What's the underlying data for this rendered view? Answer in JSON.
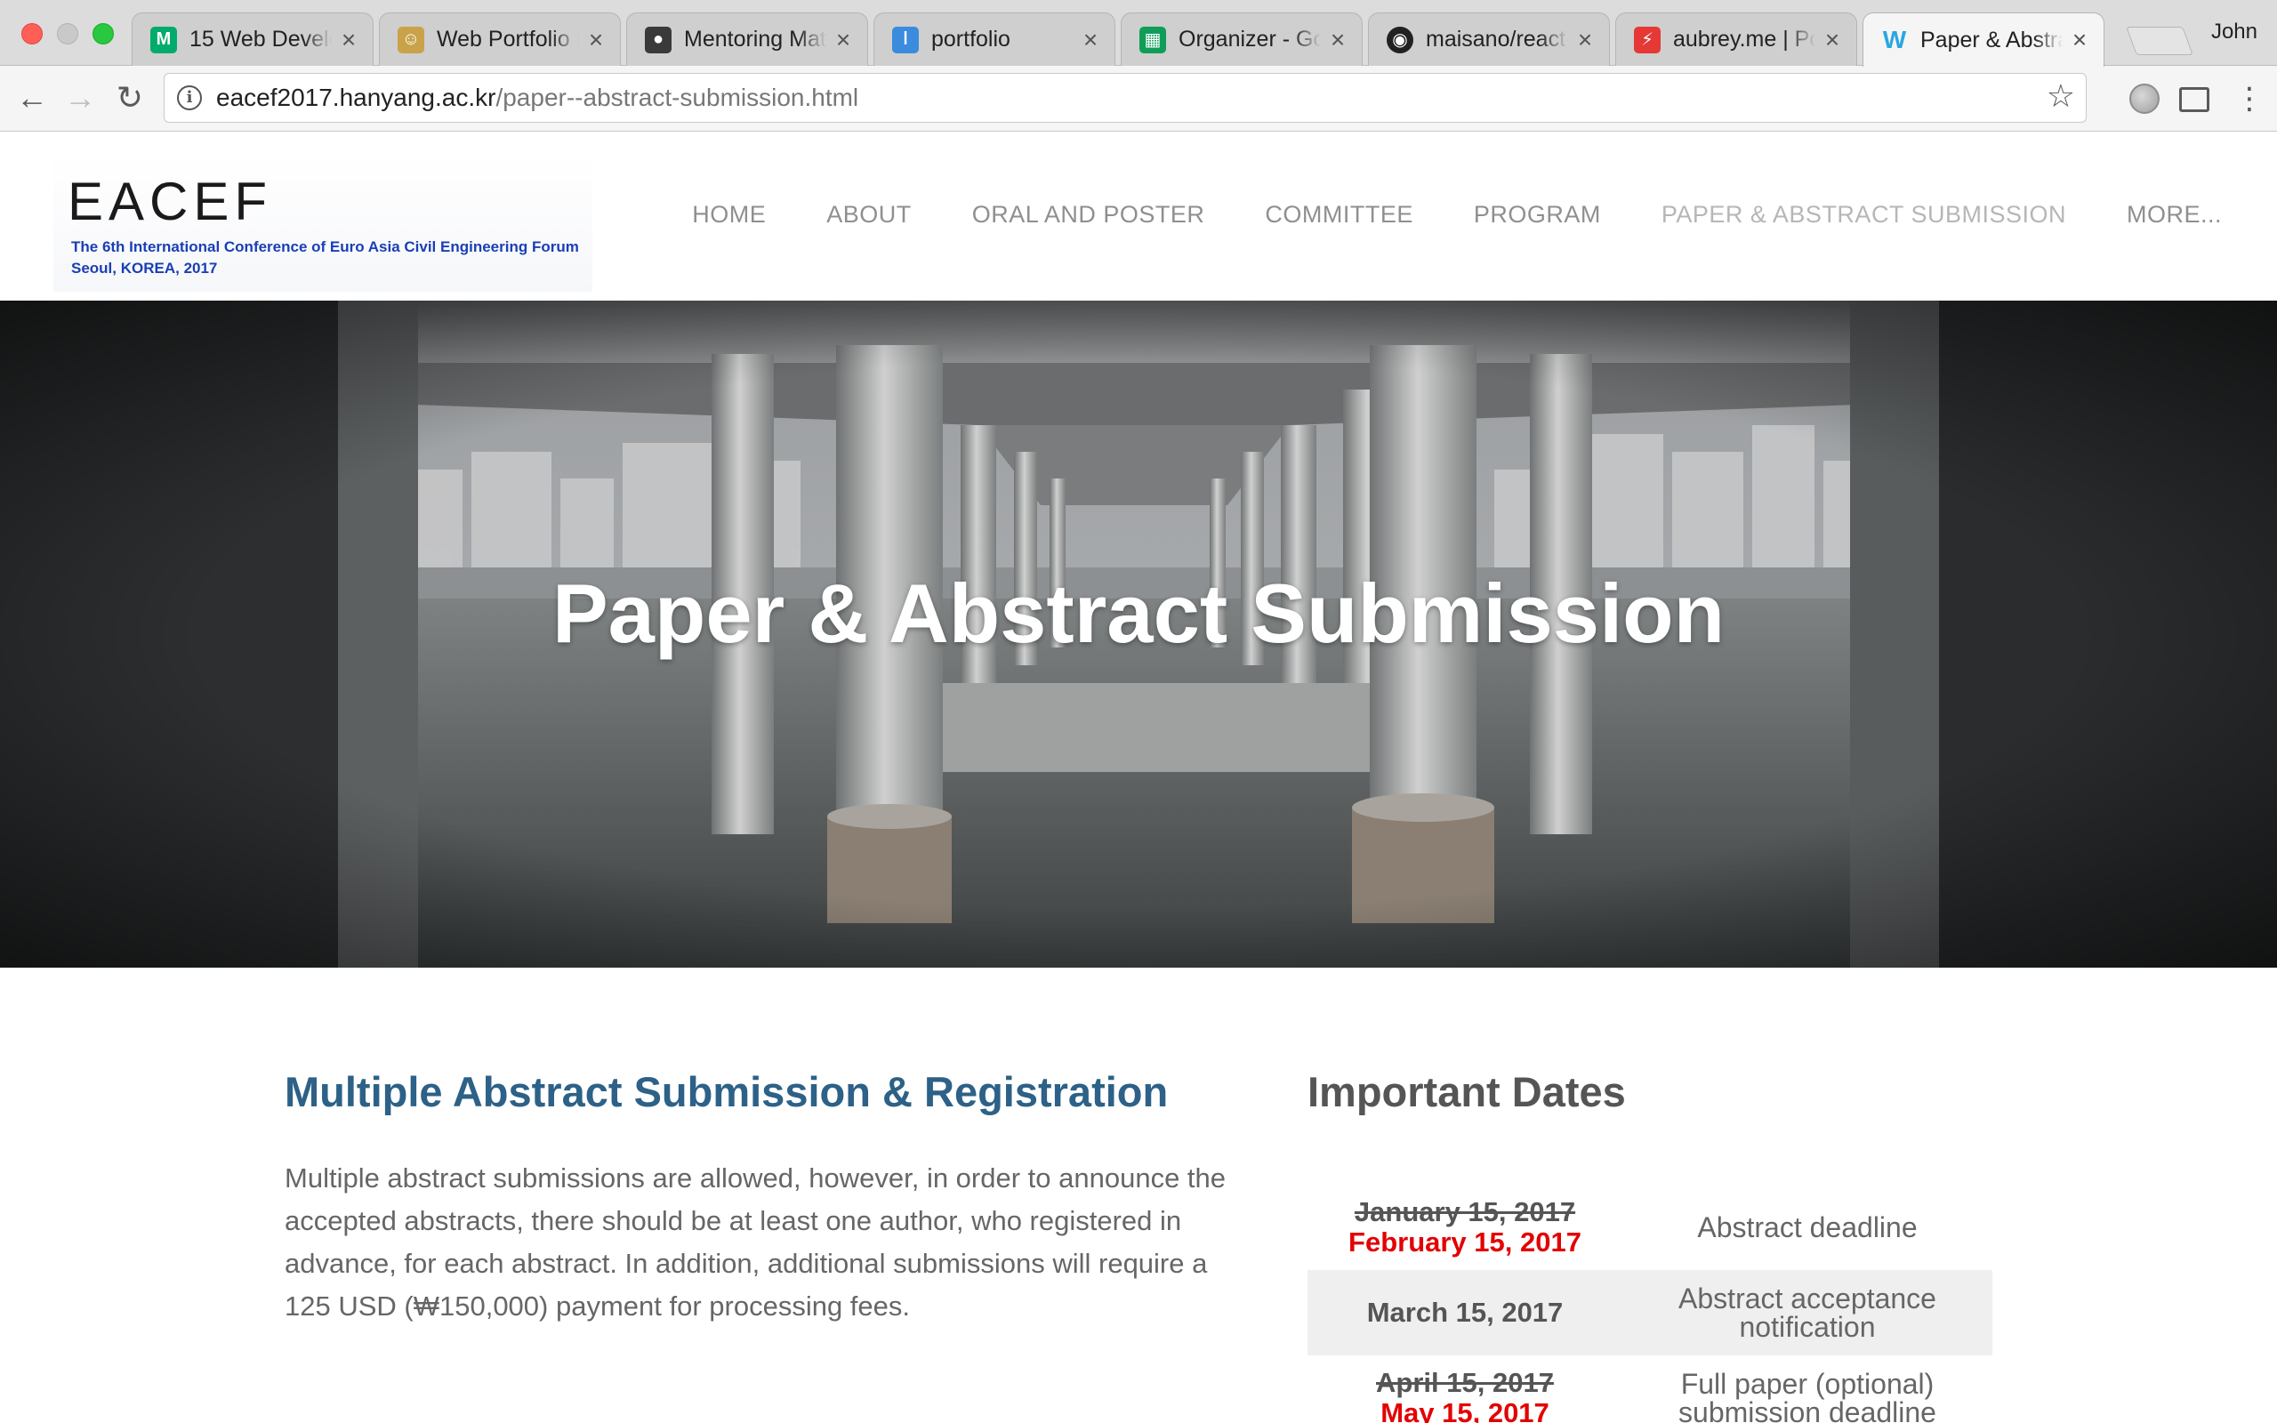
{
  "browser": {
    "tabs": [
      {
        "title": "15 Web Develo",
        "icon": "medium-icon",
        "color": "#00ab6c"
      },
      {
        "title": "Web Portfolio |",
        "icon": "avatar-icon",
        "color": "#c9a24a"
      },
      {
        "title": "Mentoring Mat",
        "icon": "mentor-icon",
        "color": "#3a3a3a"
      },
      {
        "title": "portfolio",
        "icon": "thermometer-icon",
        "color": "#3b8bde"
      },
      {
        "title": "Organizer - Go",
        "icon": "sheets-icon",
        "color": "#0f9d58"
      },
      {
        "title": "maisano/react-",
        "icon": "github-icon",
        "color": "#222222"
      },
      {
        "title": "aubrey.me | Po",
        "icon": "aubrey-icon",
        "color": "#e53935"
      },
      {
        "title": "Paper & Abstra",
        "icon": "weebly-icon",
        "color": "#2aa7e0"
      }
    ],
    "profile": "John",
    "url_host": "eacef2017.hanyang.ac.kr",
    "url_path": "/paper--abstract-submission.html"
  },
  "site": {
    "logo": {
      "word": "EACEF",
      "line1": "The 6th International Conference of Euro Asia Civil Engineering Forum",
      "line2": "Seoul, KOREA, 2017"
    },
    "nav": [
      "HOME",
      "ABOUT",
      "ORAL AND POSTER",
      "COMMITTEE",
      "PROGRAM",
      "PAPER & ABSTRACT SUBMISSION",
      "MORE..."
    ]
  },
  "hero": {
    "title": "Paper & Abstract Submission"
  },
  "content": {
    "left_heading": "Multiple Abstract Submission & Registration",
    "left_body": "Multiple abstract submissions are allowed, however, in order to announce the accepted abstracts, there should be at least one author, who registered in advance, for each abstract. In addition,  additional submissions will require a 125 USD (₩150,000) payment for processing fees.",
    "right_heading": "Important Dates",
    "dates": [
      {
        "old": "January 15, 2017",
        "date": "February 15, 2017",
        "desc1": "Abstract deadline",
        "desc2": ""
      },
      {
        "old": "",
        "date": "March 15, 2017",
        "desc1": "Abstract acceptance",
        "desc2": "notification"
      },
      {
        "old": "April 15, 2017",
        "date": "May 15, 2017",
        "desc1": "Full paper (optional)",
        "desc2": "submission deadline"
      }
    ]
  },
  "colors": {
    "heading_blue": "#2d6187",
    "deadline_red": "#e30000"
  }
}
